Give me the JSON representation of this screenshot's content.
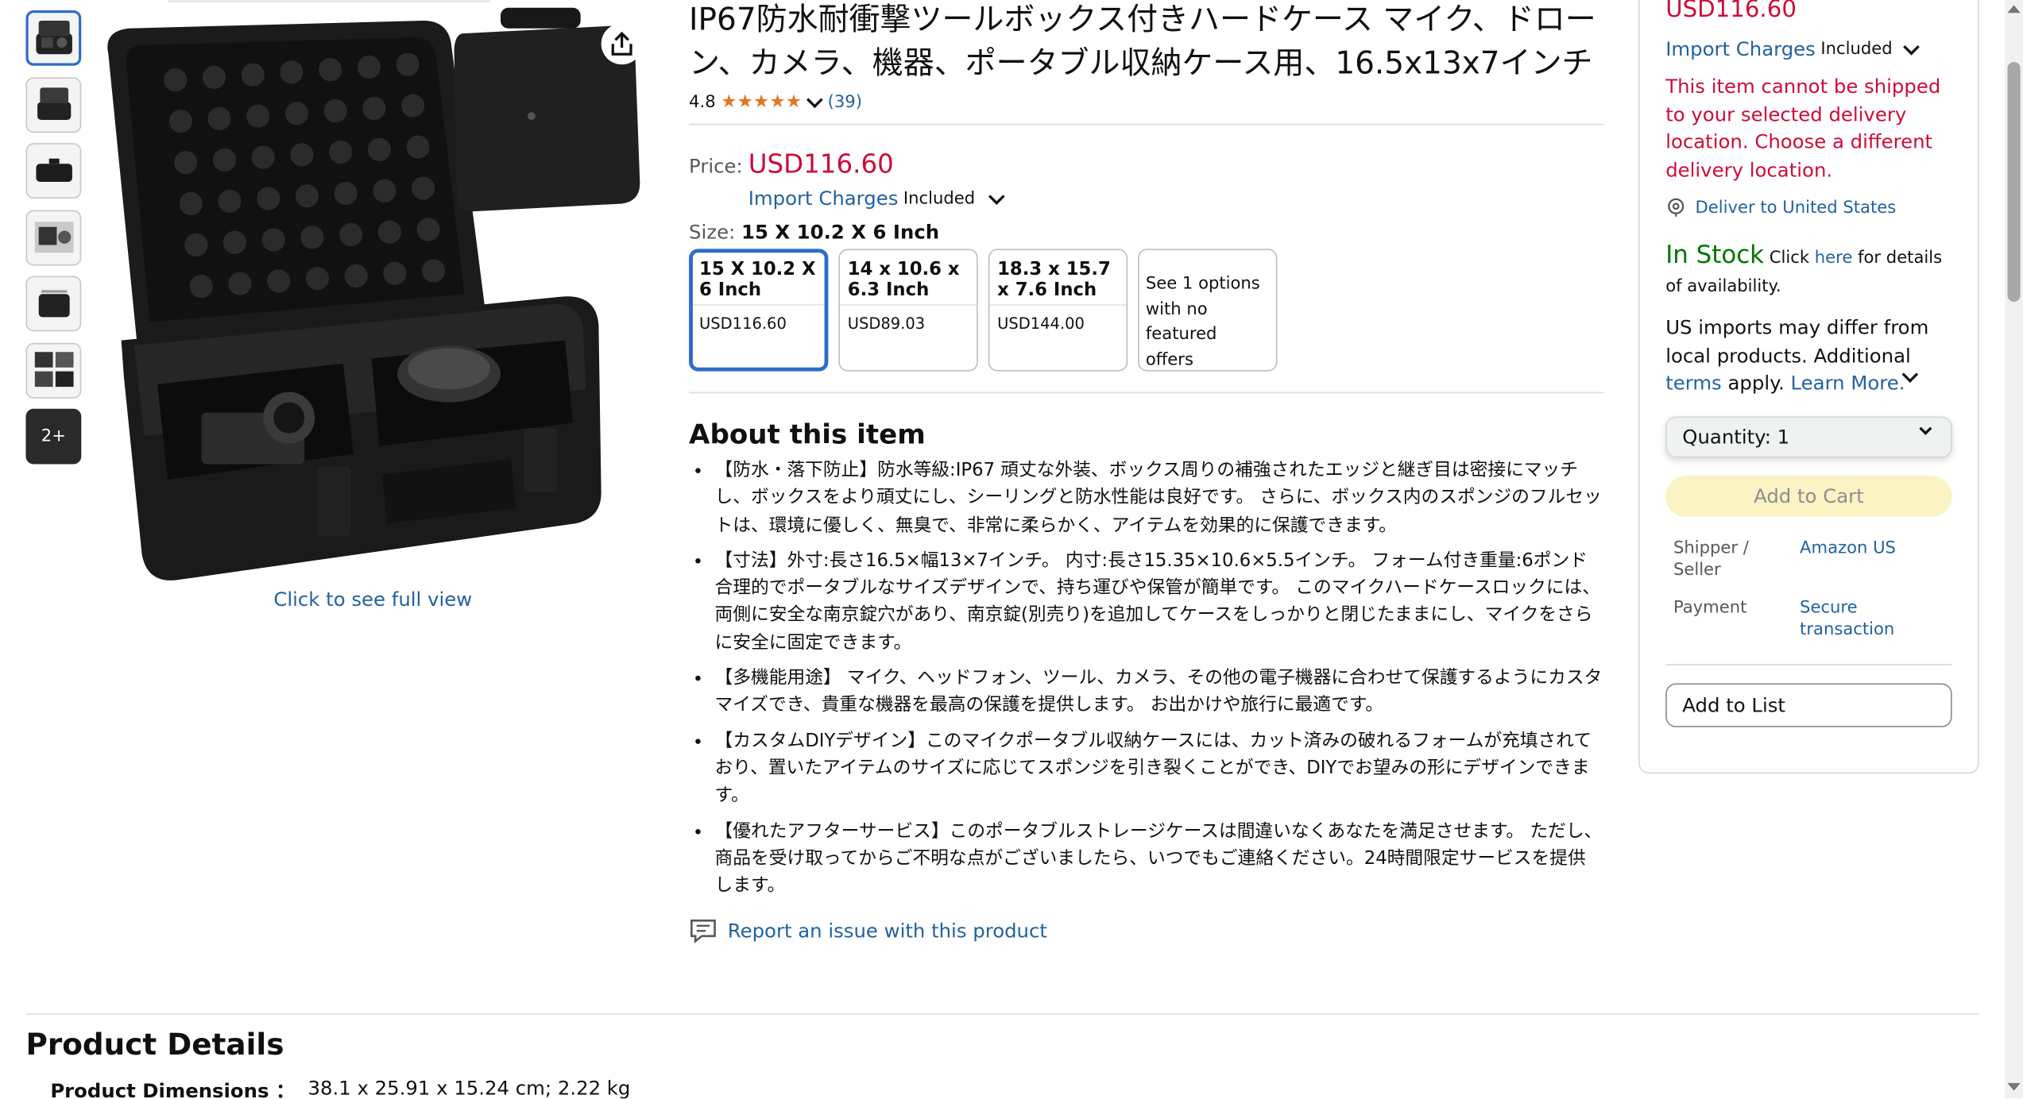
{
  "gallery": {
    "thumbnails": [
      "case-open-angle",
      "case-open-front",
      "case-closed-side",
      "case-accessories",
      "case-with-gear",
      "case-feature-collage"
    ],
    "more_label": "2+",
    "full_view_link": "Click to see full view"
  },
  "product": {
    "title": "IP67防水耐衝撃ツールボックス付きハードケース マイク、ドローン、カメラ、機器、ポータブル収納ケース用、16.5x13x7インチ",
    "rating": "4.8",
    "rating_value": 4.8,
    "rating_count": "(39)",
    "price_label": "Price:",
    "price": "USD116.60",
    "import_charges_link": "Import Charges",
    "import_included": "Included",
    "size_label": "Size:",
    "size_selected": "15 X 10.2 X 6 Inch",
    "size_options": [
      {
        "label": "15 X 10.2 X 6 Inch",
        "price": "USD116.60",
        "selected": true
      },
      {
        "label": "14 x 10.6 x 6.3 Inch",
        "price": "USD89.03",
        "selected": false
      },
      {
        "label": "18.3 x 15.7 x 7.6 Inch",
        "price": "USD144.00",
        "selected": false
      }
    ],
    "more_options": "See 1 options with no featured offers"
  },
  "about": {
    "heading": "About this item",
    "bullets": [
      "【防水・落下防止】防水等級:IP67 頑丈な外装、ボックス周りの補強されたエッジと継ぎ目は密接にマッチし、ボックスをより頑丈にし、シーリングと防水性能は良好です。 さらに、ボックス内のスポンジのフルセットは、環境に優しく、無臭で、非常に柔らかく、アイテムを効果的に保護できます。",
      "【寸法】外寸:長さ16.5×幅13×7インチ。 内寸:長さ15.35×10.6×5.5インチ。 フォーム付き重量:6ポンド 合理的でポータブルなサイズデザインで、持ち運びや保管が簡単です。 このマイクハードケースロックには、両側に安全な南京錠穴があり、南京錠(別売り)を追加してケースをしっかりと閉じたままにし、マイクをさらに安全に固定できます。",
      "【多機能用途】 マイク、ヘッドフォン、ツール、カメラ、その他の電子機器に合わせて保護するようにカスタマイズでき、貴重な機器を最高の保護を提供します。 お出かけや旅行に最適です。",
      "【カスタムDIYデザイン】このマイクポータブル収納ケースには、カット済みの破れるフォームが充填されており、置いたアイテムのサイズに応じてスポンジを引き裂くことができ、DIYでお望みの形にデザインできます。",
      "【優れたアフターサービス】このポータブルストレージケースは間違いなくあなたを満足させます。 ただし、商品を受け取ってからご不明な点がございましたら、いつでもご連絡ください。24時間限定サービスを提供します。"
    ],
    "report_link": "Report an issue with this product"
  },
  "buybox": {
    "price": "USD116.60",
    "import_charges_link": "Import Charges",
    "import_included": "Included",
    "warning": "This item cannot be shipped to your selected delivery location. Choose a different delivery location.",
    "deliver_to": "Deliver to United States",
    "in_stock": "In Stock",
    "click_text": " Click ",
    "here_link": "here",
    "details_text": " for details of availability.",
    "us_imports_text": "US imports may differ from local products. Additional ",
    "terms_link": "terms",
    "apply_text": " apply. ",
    "learn_more_link": "Learn More.",
    "quantity_label": "Quantity:",
    "quantity_value": "1",
    "add_to_cart": "Add to Cart",
    "shipper_label": "Shipper / Seller",
    "shipper_value": "Amazon US",
    "payment_label": "Payment",
    "payment_value": "Secure transaction",
    "add_to_list": "Add to List"
  },
  "details": {
    "heading": "Product Details",
    "dimensions_label": "Product Dimensions ：",
    "dimensions_value": "38.1 x 25.91 x 15.24 cm; 2.22 kg"
  },
  "colors": {
    "price_red": "#cc0c39",
    "link_blue": "#2162a1",
    "in_stock_green": "#007600",
    "star_orange": "#de7921",
    "selected_border": "#2f6ccb",
    "cart_yellow": "#fcf3c4"
  }
}
